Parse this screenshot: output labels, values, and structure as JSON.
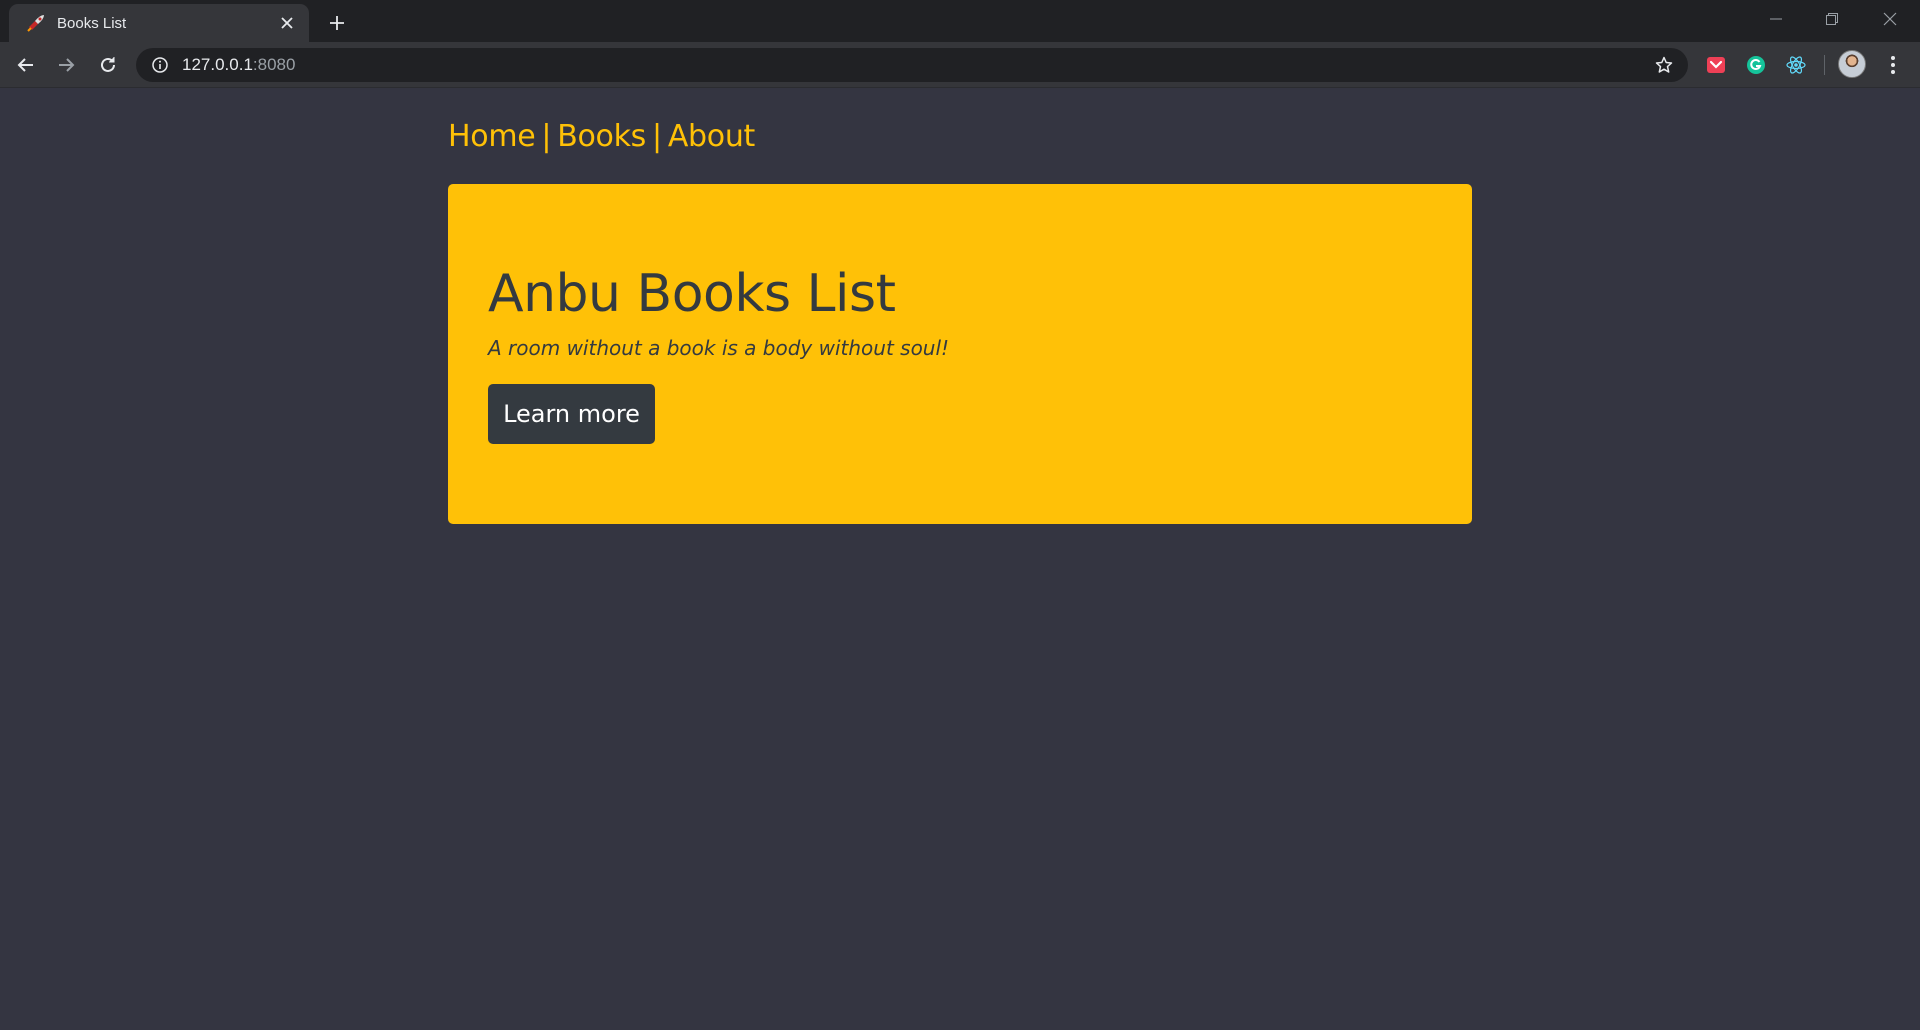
{
  "browser": {
    "tab": {
      "title": "Books List",
      "favicon": "rocket-icon"
    },
    "address": {
      "host": "127.0.0.1",
      "port": ":8080"
    },
    "extensions": [
      "pocket-icon",
      "grammarly-icon",
      "react-devtools-icon"
    ]
  },
  "page": {
    "nav": {
      "items": [
        {
          "label": "Home"
        },
        {
          "label": "Books"
        },
        {
          "label": "About"
        }
      ],
      "separator": "|"
    },
    "hero": {
      "title": "Anbu Books List",
      "subtitle": "A room without a book is a body without soul!",
      "button_label": "Learn more"
    }
  },
  "colors": {
    "page_bg": "#343541",
    "accent": "#ffc107",
    "dark": "#343a40"
  }
}
